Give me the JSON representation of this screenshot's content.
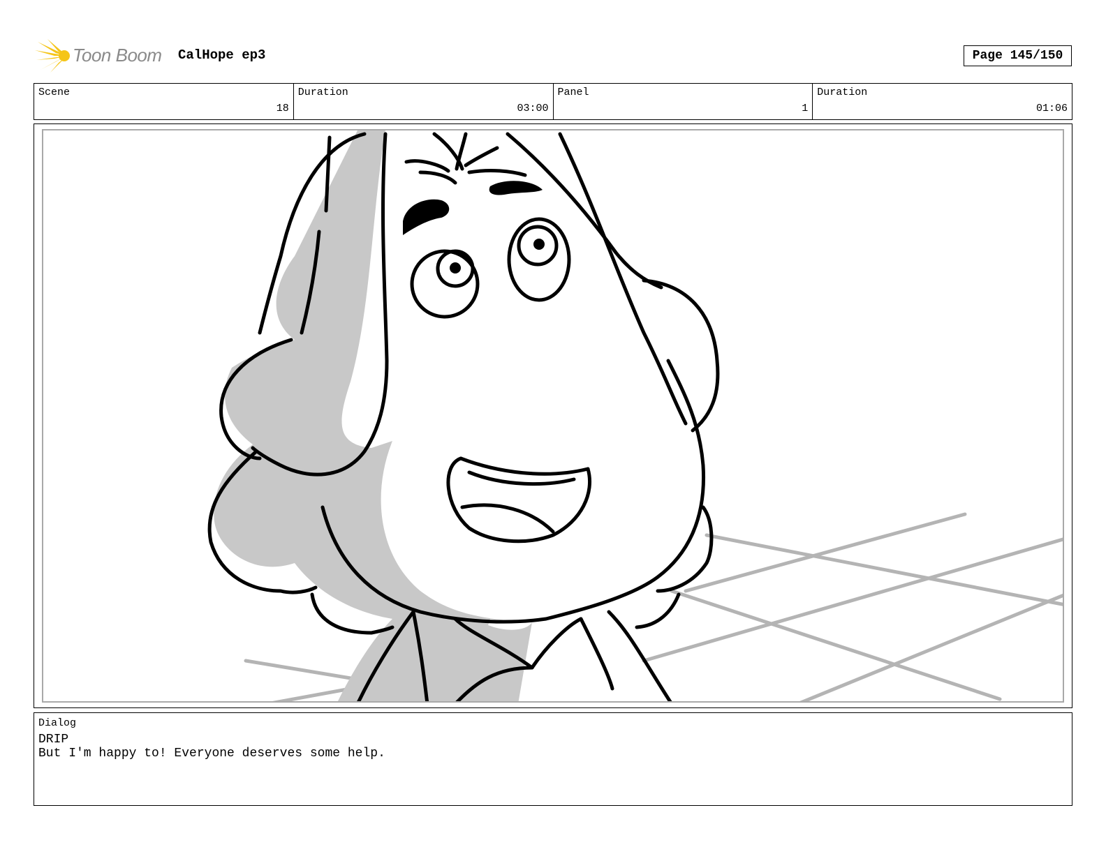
{
  "header": {
    "logo_text": "Toon Boom",
    "logo_icon": "starburst-logo-icon",
    "project_title": "CalHope ep3",
    "page_label": "Page 145/150"
  },
  "info": {
    "scene_label": "Scene",
    "scene_value": "18",
    "scene_duration_label": "Duration",
    "scene_duration_value": "03:00",
    "panel_label": "Panel",
    "panel_value": "1",
    "panel_duration_label": "Duration",
    "panel_duration_value": "01:06"
  },
  "panel": {
    "image_desc_icon": "storyboard-sketch-character-closeup"
  },
  "dialog": {
    "label": "Dialog",
    "speaker": "DRIP",
    "line": "But I'm happy to! Everyone deserves some help."
  },
  "colors": {
    "logo_yellow": "#f5c518",
    "logo_text": "#8a8a8a",
    "panel_border": "#a9a9a9",
    "sketch_shade": "#c8c8c8"
  }
}
